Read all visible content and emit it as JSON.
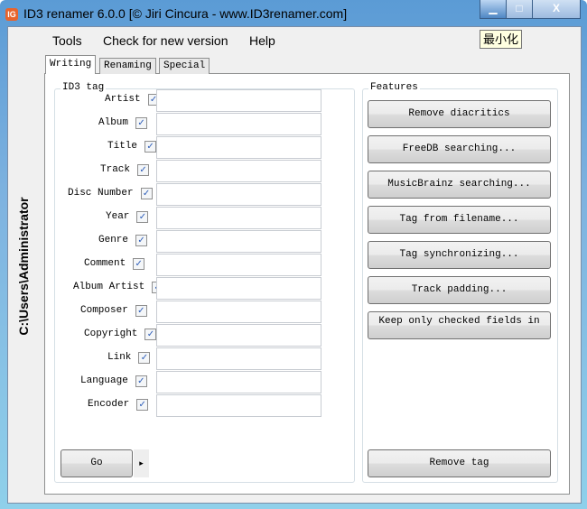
{
  "window": {
    "title": "ID3 renamer 6.0.0 [© Jiri Cincura - www.ID3renamer.com]",
    "tooltip": "最小化",
    "minimize": "▁",
    "maximize": "□",
    "close": "X",
    "app_icon": "IG"
  },
  "menu": [
    "Tools",
    "Check for new version",
    "Help"
  ],
  "sidebar": {
    "path": "C:\\Users\\Administrator"
  },
  "tabs": [
    "Writing",
    "Renaming",
    "Special"
  ],
  "id3_group": {
    "label": "ID3 tag",
    "fields": [
      {
        "label": "Artist",
        "checked": true,
        "value": ""
      },
      {
        "label": "Album",
        "checked": true,
        "value": ""
      },
      {
        "label": "Title",
        "checked": true,
        "value": ""
      },
      {
        "label": "Track",
        "checked": true,
        "value": ""
      },
      {
        "label": "Disc Number",
        "checked": true,
        "value": ""
      },
      {
        "label": "Year",
        "checked": true,
        "value": ""
      },
      {
        "label": "Genre",
        "checked": true,
        "value": ""
      },
      {
        "label": "Comment",
        "checked": true,
        "value": ""
      },
      {
        "label": "Album Artist",
        "checked": true,
        "value": ""
      },
      {
        "label": "Composer",
        "checked": true,
        "value": ""
      },
      {
        "label": "Copyright",
        "checked": true,
        "value": ""
      },
      {
        "label": "Link",
        "checked": true,
        "value": ""
      },
      {
        "label": "Language",
        "checked": true,
        "value": ""
      },
      {
        "label": "Encoder",
        "checked": true,
        "value": ""
      }
    ],
    "go": "Go",
    "go_arrow": "▸"
  },
  "features_group": {
    "label": "Features",
    "buttons": [
      "Remove diacritics",
      "FreeDB searching...",
      "MusicBrainz searching...",
      "Tag from filename...",
      "Tag synchronizing...",
      "Track padding...",
      "Keep only checked fields in"
    ],
    "remove_tag": "Remove tag"
  }
}
